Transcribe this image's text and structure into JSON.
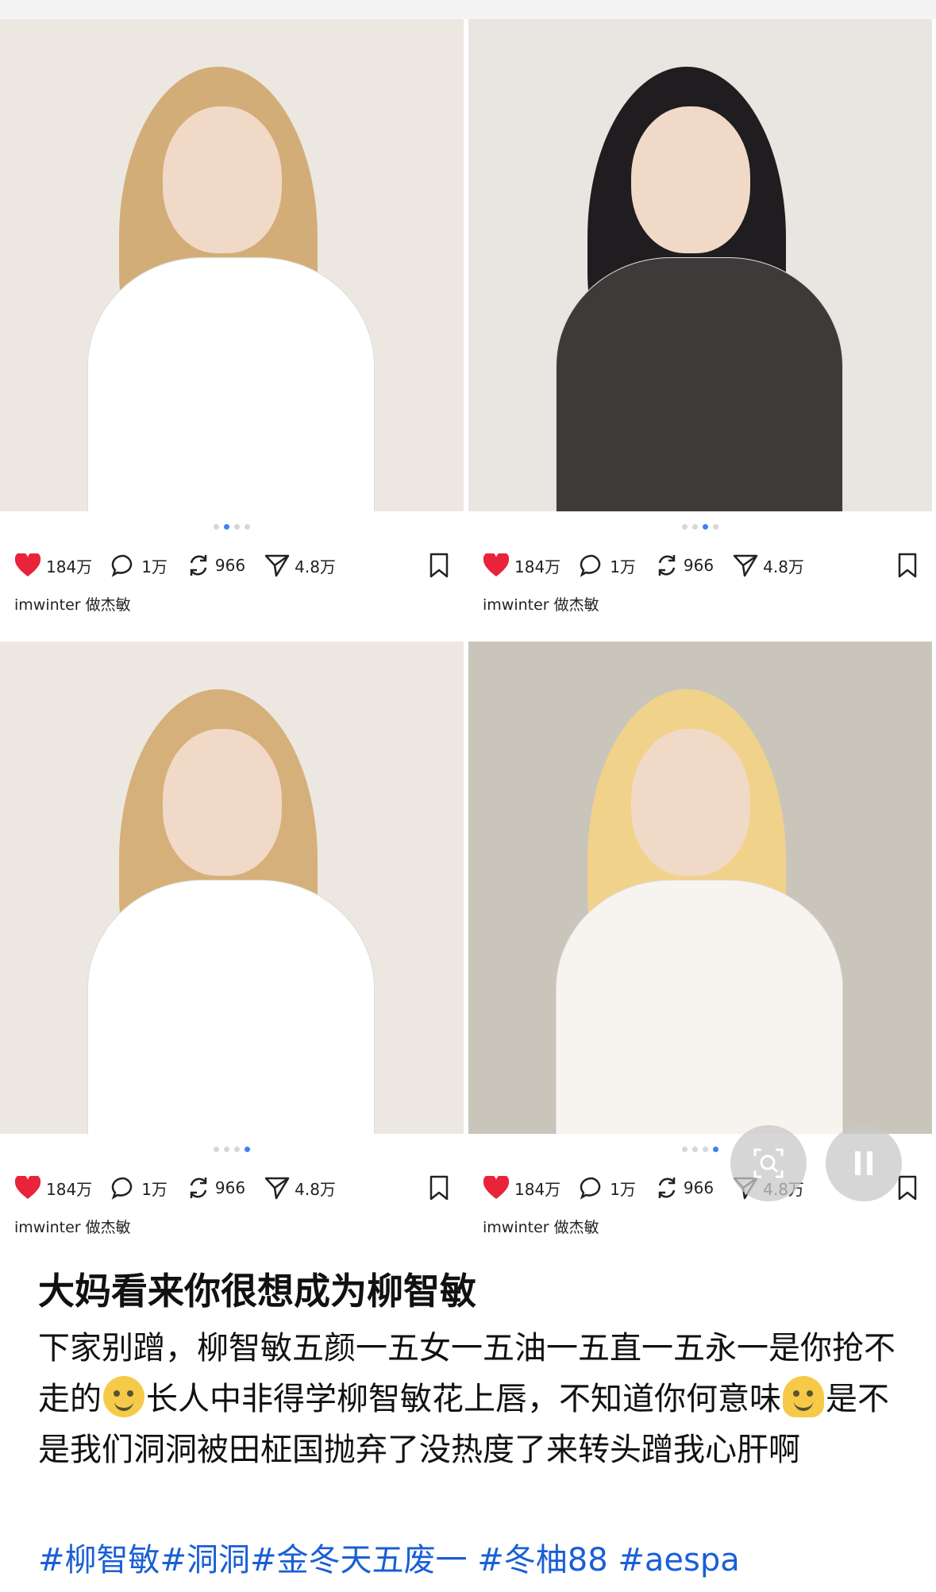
{
  "posts": [
    {
      "likes": "184万",
      "comments": "1万",
      "reposts": "966",
      "shares": "4.8万",
      "user": "imwinter 做杰敏",
      "dots": 4,
      "active_dot": 1,
      "colors": {
        "bg": "#ece8e1",
        "hair": "#d3ad78",
        "shirt": "#ffffff"
      }
    },
    {
      "likes": "184万",
      "comments": "1万",
      "reposts": "966",
      "shares": "4.8万",
      "user": "imwinter 做杰敏",
      "dots": 4,
      "active_dot": 2,
      "colors": {
        "bg": "#e9e6e2",
        "hair": "#1f1d1f",
        "shirt": "#3c3b3a"
      }
    },
    {
      "likes": "184万",
      "comments": "1万",
      "reposts": "966",
      "shares": "4.8万",
      "user": "imwinter 做杰敏",
      "dots": 4,
      "active_dot": 3,
      "colors": {
        "bg": "#ece8e1",
        "hair": "#d6b07a",
        "shirt": "#ffffff"
      }
    },
    {
      "likes": "184万",
      "comments": "1万",
      "reposts": "966",
      "shares": "4.8万",
      "user": "imwinter 做杰敏",
      "dots": 4,
      "active_dot": 3,
      "colors": {
        "bg": "#c9c5bb",
        "hair": "#f1d28a",
        "shirt": "#f7f4ef"
      }
    }
  ],
  "post_text": {
    "title": "大妈看来你很想成为柳智敏",
    "body_part1": "下家别蹭，柳智敏五颜一五女一五油一五直一五永一是你抢不走的",
    "body_part2": "长人中非得学柳智敏花上唇，不知道你何意味",
    "body_part3": "是不是我们洞洞被田柾国抛弃了没热度了来转头蹭我心肝啊",
    "hashtags": "#柳智敏#洞洞#金冬天五废一 #冬柚88 #aespa"
  },
  "icons": {
    "like": "heart-icon",
    "comment": "comment-bubble-icon",
    "repost": "repost-icon",
    "share": "share-arrow-icon",
    "bookmark": "bookmark-icon",
    "scan": "image-search-icon",
    "pause": "pause-icon",
    "emoji1": "rofl-emoji-icon",
    "emoji2": "melting-face-emoji-icon"
  },
  "colors": {
    "accent": "#1a5fd6",
    "heart": "#e8233a",
    "active_dot": "#3b82f6"
  }
}
